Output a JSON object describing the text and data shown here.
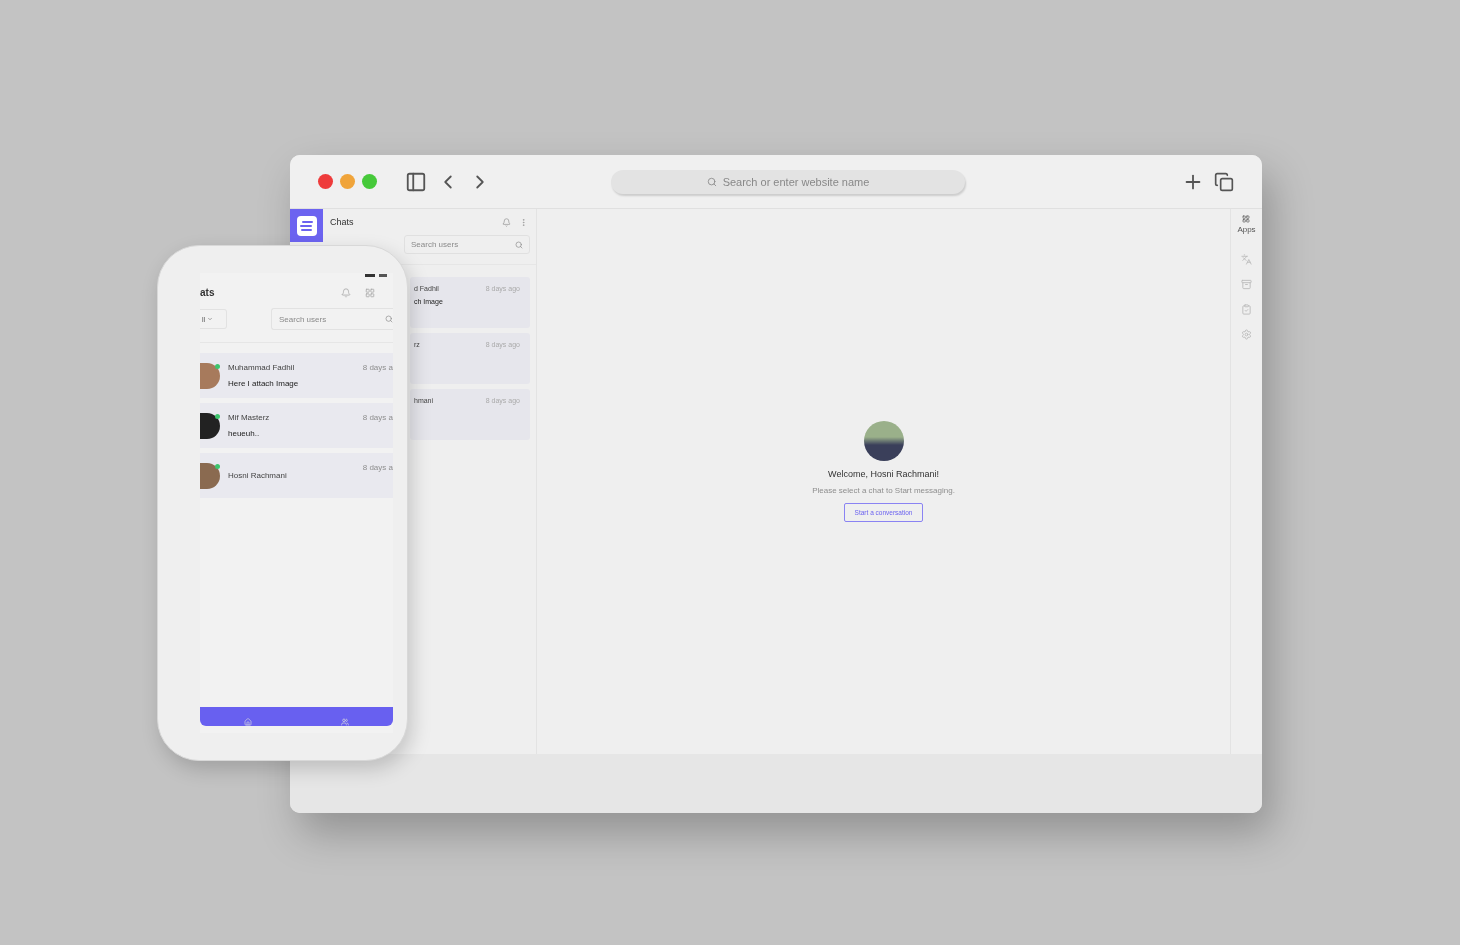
{
  "browser": {
    "address_bar": {
      "placeholder": "Search or enter website name"
    },
    "chat_panel": {
      "title": "Chats",
      "search": {
        "placeholder": "Search users"
      },
      "chats": [
        {
          "name": "d Fadhil",
          "message": "ch Image",
          "time": "8 days ago"
        },
        {
          "name": "rz",
          "time": "8 days ago"
        },
        {
          "name": "hmani",
          "time": "8 days ago"
        }
      ]
    },
    "welcome": {
      "title": "Welcome, Hosni Rachmani!",
      "subtitle": "Please select a chat to Start messaging.",
      "button": "Start a conversation"
    },
    "right_rail": {
      "apps_label": "Apps"
    }
  },
  "phone": {
    "title": "ats",
    "filter": "ll",
    "search": {
      "placeholder": "Search users"
    },
    "chats": [
      {
        "name": "Muhammad Fadhil",
        "message": "Here I attach Image",
        "time": "8 days a",
        "online": true
      },
      {
        "name": "Mif Masterz",
        "message": "heueuh..",
        "time": "8 days a",
        "online": true
      },
      {
        "name": "Hosni Rachmani",
        "time": "8 days a",
        "online": true
      }
    ]
  }
}
